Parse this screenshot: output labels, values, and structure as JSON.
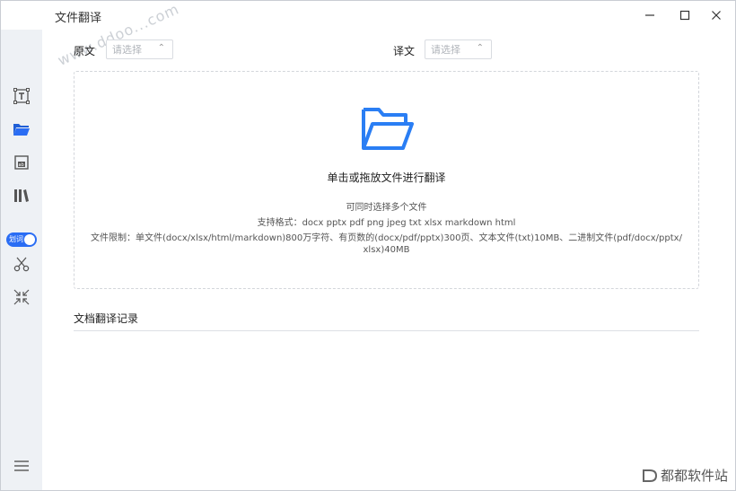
{
  "window": {
    "title": "文件翻译",
    "minimize_icon": "minimize-icon",
    "maximize_icon": "maximize-icon",
    "close_icon": "close-icon"
  },
  "sidebar": {
    "items": [
      {
        "name": "text-translate-icon"
      },
      {
        "name": "folder-icon"
      },
      {
        "name": "image-translate-icon"
      },
      {
        "name": "library-icon"
      },
      {
        "name": "scissors-icon"
      },
      {
        "name": "shrink-icon"
      }
    ],
    "toggle_label": "划词",
    "menu_icon": "menu-icon"
  },
  "source": {
    "label": "原文",
    "placeholder": "请选择"
  },
  "target": {
    "label": "译文",
    "placeholder": "请选择"
  },
  "dropzone": {
    "title": "单击或拖放文件进行翻译",
    "hint1": "可同时选择多个文件",
    "hint2": "支持格式：docx pptx pdf png jpeg txt xlsx markdown html",
    "hint3": "文件限制：单文件(docx/xlsx/html/markdown)800万字符、有页数的(docx/pdf/pptx)300页、文本文件(txt)10MB、二进制文件(pdf/docx/pptx/",
    "hint4": "xlsx)40MB"
  },
  "history": {
    "title": "文档翻译记录"
  },
  "watermark": "www.ddoo...com",
  "brand": "都都软件站",
  "colors": {
    "accent": "#2a6df4",
    "sidebar_bg": "#eef1f5"
  }
}
